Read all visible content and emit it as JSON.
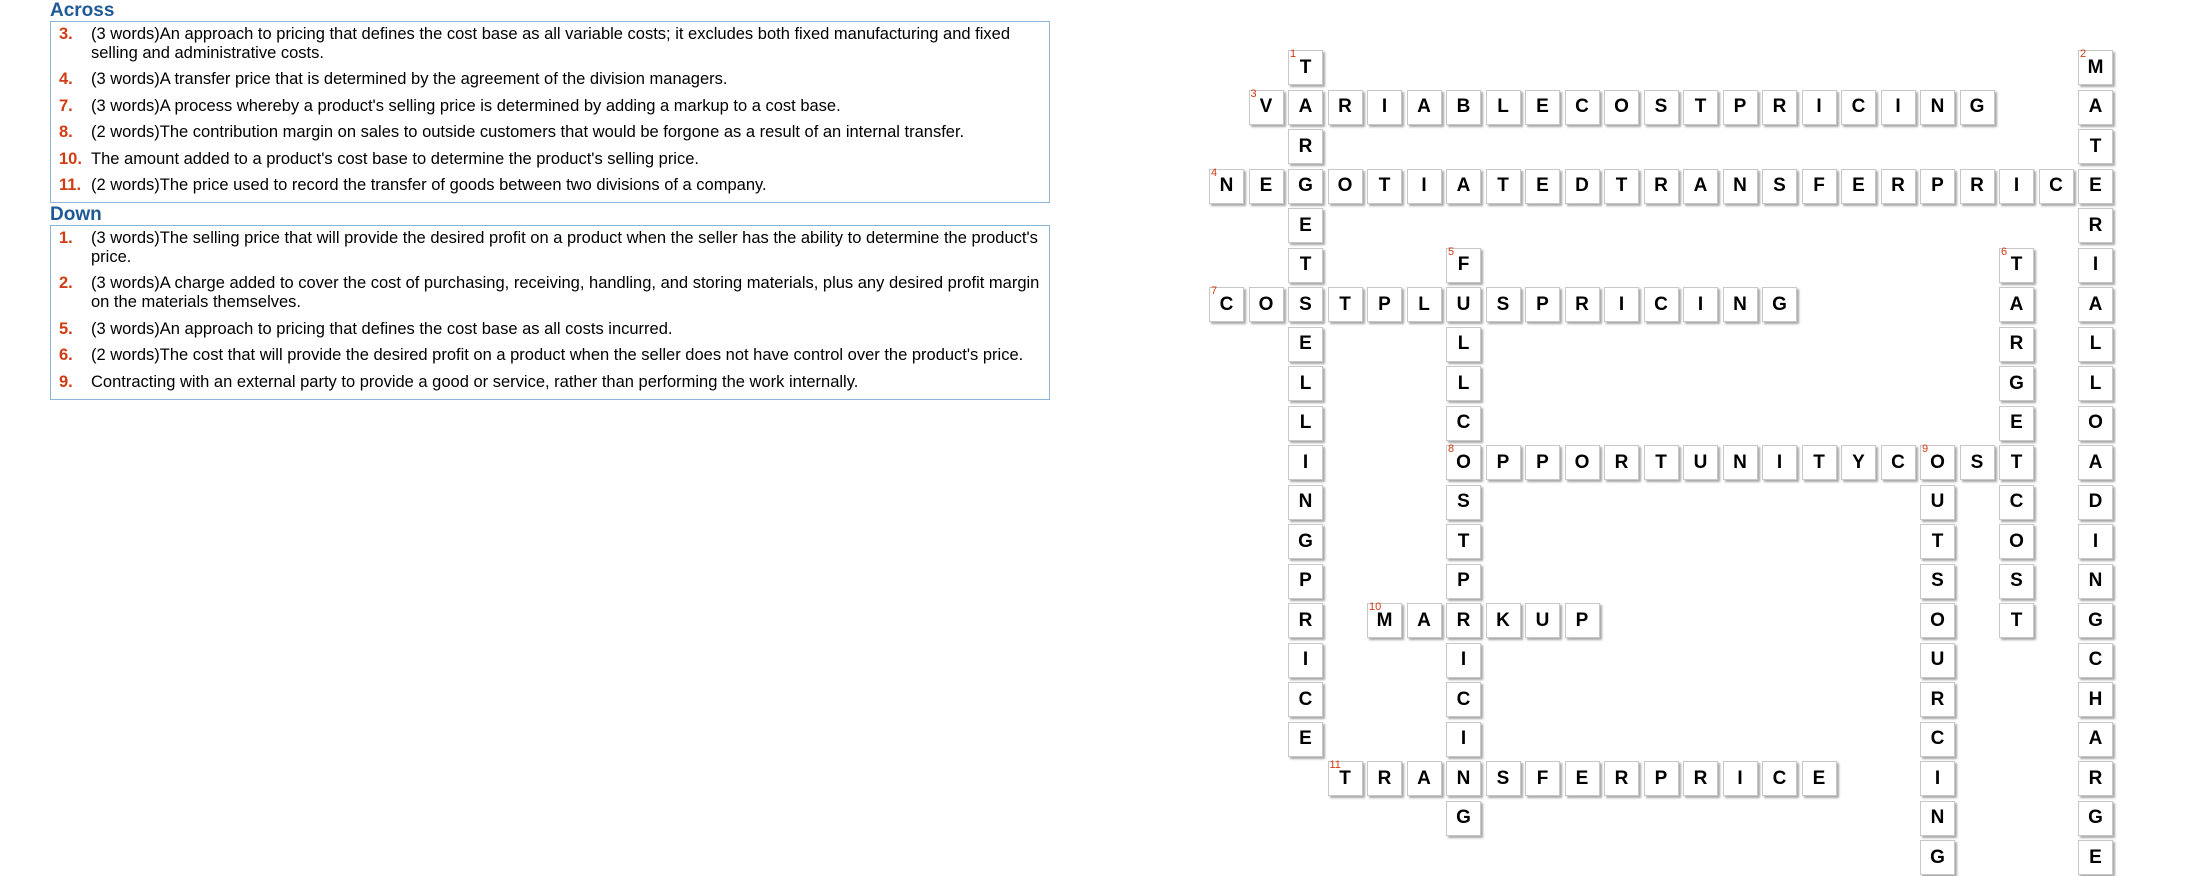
{
  "across": {
    "heading": "Across",
    "clues": [
      {
        "num": "3.",
        "text": "(3 words)An approach to pricing that defines the cost base as all variable costs; it excludes both fixed manufacturing and fixed selling and administrative costs."
      },
      {
        "num": "4.",
        "text": "(3 words)A transfer price that is determined by the agreement of the division managers."
      },
      {
        "num": "7.",
        "text": "(3 words)A process whereby a product's selling price is determined by adding a markup to a cost base."
      },
      {
        "num": "8.",
        "text": "(2 words)The contribution margin on sales to outside customers that would be forgone as a result of an internal transfer."
      },
      {
        "num": "10.",
        "text": "The amount added to a product's cost base to determine the product's selling price."
      },
      {
        "num": "11.",
        "text": "(2 words)The price used to record the transfer of goods between two divisions of a company."
      }
    ]
  },
  "down": {
    "heading": "Down",
    "clues": [
      {
        "num": "1.",
        "text": "(3 words)The selling price that will provide the desired profit on a product when the seller has the ability to determine the product's price."
      },
      {
        "num": "2.",
        "text": "(3 words)A charge added to cover the cost of purchasing, receiving, handling, and storing materials, plus any desired profit margin on the materials themselves."
      },
      {
        "num": "5.",
        "text": "(3 words)An approach to pricing that defines the cost base as all costs incurred."
      },
      {
        "num": "6.",
        "text": "(2 words)The cost that will provide the desired profit on a product when the seller does not have control over the product's price."
      },
      {
        "num": "9.",
        "text": "Contracting with an external party to provide a good or service, rather than performing the work internally."
      }
    ]
  },
  "grid": {
    "words": [
      {
        "num": "1",
        "dir": "down",
        "row": 0,
        "col": 2,
        "answer": "TARGETSELLINGPRICE"
      },
      {
        "num": "2",
        "dir": "down",
        "row": 0,
        "col": 22,
        "answer": "MATERIALLOADINGCHARGE"
      },
      {
        "num": "3",
        "dir": "across",
        "row": 1,
        "col": 1,
        "answer": "VARIABLECOSTPRICING"
      },
      {
        "num": "4",
        "dir": "across",
        "row": 3,
        "col": 0,
        "answer": "NEGOTIATEDTRANSFERPRICE"
      },
      {
        "num": "5",
        "dir": "down",
        "row": 5,
        "col": 6,
        "answer": "FULLCOSTPRICING"
      },
      {
        "num": "6",
        "dir": "down",
        "row": 5,
        "col": 20,
        "answer": "TARGETCOST"
      },
      {
        "num": "7",
        "dir": "across",
        "row": 6,
        "col": 0,
        "answer": "COSTPLUSPRICING"
      },
      {
        "num": "8",
        "dir": "across",
        "row": 10,
        "col": 6,
        "answer": "OPPORTUNITYCOST"
      },
      {
        "num": "9",
        "dir": "down",
        "row": 10,
        "col": 18,
        "answer": "OUTSOURCING"
      },
      {
        "num": "10",
        "dir": "across",
        "row": 14,
        "col": 4,
        "answer": "MARKUP"
      },
      {
        "num": "11",
        "dir": "across",
        "row": 18,
        "col": 3,
        "answer": "TRANSFERPRICE"
      }
    ]
  }
}
